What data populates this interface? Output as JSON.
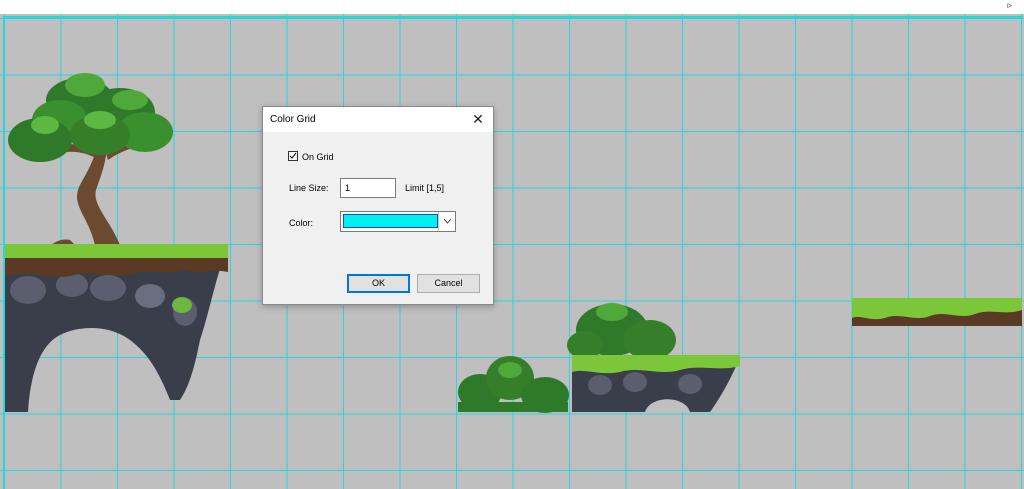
{
  "dialog": {
    "title": "Color Grid",
    "close_glyph": "✕",
    "on_grid_label": "On Grid",
    "on_grid_checked": true,
    "line_size_label": "Line Size:",
    "line_size_value": "1",
    "limit_text": "Limit [1,5]",
    "color_label": "Color:",
    "color_value": "#00f0f0",
    "ok_label": "OK",
    "cancel_label": "Cancel"
  },
  "canvas": {
    "grid_color": "#27d6df",
    "background_color": "#bfbfbf"
  },
  "icons": {
    "top_arrow": "play-arrow-icon",
    "close": "close-icon",
    "check": "check-icon",
    "dropdown": "chevron-down-icon"
  }
}
